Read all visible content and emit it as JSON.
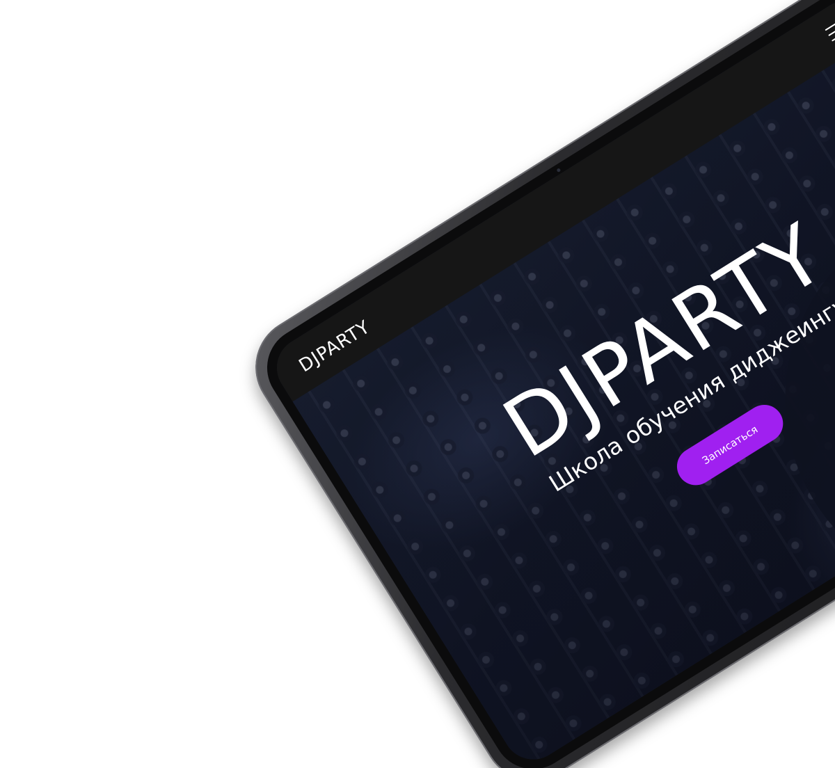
{
  "header": {
    "logo": "DJPARTY",
    "menu_icon": "hamburger-menu-icon"
  },
  "hero": {
    "title": "DJPARTY",
    "subtitle": "Школа обучения диджеингу",
    "cta_label": "Записаться",
    "background": "dj-controller-image"
  },
  "colors": {
    "cta_background": "#a020f0",
    "topbar_background": "#161616",
    "text": "#ffffff"
  }
}
